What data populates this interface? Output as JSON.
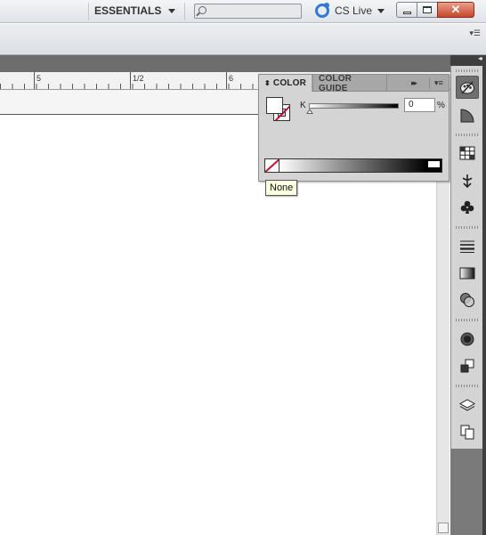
{
  "titlebar": {
    "workspace_label": "ESSENTIALS",
    "search_placeholder": "",
    "cslive_label": "CS Live",
    "close_glyph": "✕"
  },
  "controlbar": {
    "panel_menu_glyph": "▾☰"
  },
  "ruler": {
    "labels": [
      "5",
      "1/2",
      "6"
    ]
  },
  "color_panel": {
    "tabs": [
      {
        "label": "COLOR",
        "active": true
      },
      {
        "label": "COLOR GUIDE",
        "active": false
      }
    ],
    "collapse_glyph": "⬍",
    "forward_glyph": "▸▸",
    "menu_glyph": "▾≡",
    "channel_label": "K",
    "channel_value": "0",
    "percent": "%",
    "fill": "#ffffff",
    "stroke": "none",
    "accent_none": "#c4122f"
  },
  "tooltip": {
    "text": "None"
  },
  "dock": {
    "collapse_glyph": "◂◂",
    "icons": [
      "swatches-palette-icon",
      "stroke-icon",
      "swatch-grid-icon",
      "symbol-sprayer-icon",
      "club-symbol-icon",
      "lines-icon",
      "gradient-icon",
      "transparency-icon",
      "appearance-icon",
      "graphic-styles-icon",
      "layers-icon",
      "artboards-icon"
    ]
  }
}
